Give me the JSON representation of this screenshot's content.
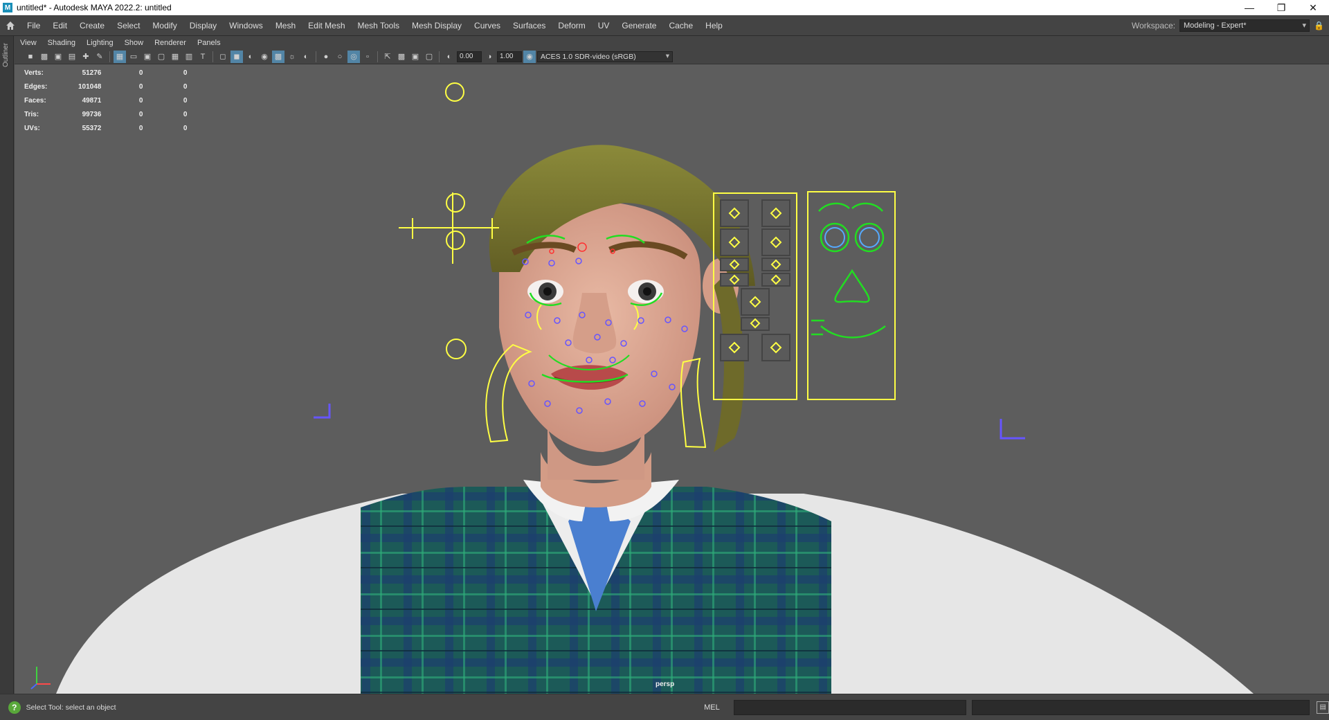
{
  "window": {
    "title": "untitled* - Autodesk MAYA 2022.2: untitled",
    "icon": "maya-icon",
    "controls": [
      "minimize-icon",
      "restore-icon",
      "close-icon"
    ]
  },
  "menubar": {
    "items": [
      "File",
      "Edit",
      "Create",
      "Select",
      "Modify",
      "Display",
      "Windows",
      "Mesh",
      "Edit Mesh",
      "Mesh Tools",
      "Mesh Display",
      "Curves",
      "Surfaces",
      "Deform",
      "UV",
      "Generate",
      "Cache",
      "Help"
    ],
    "workspace_label": "Workspace:",
    "workspace_value": "Modeling - Expert*"
  },
  "outliner": {
    "label": "Outliner"
  },
  "panel_menu": {
    "items": [
      "View",
      "Shading",
      "Lighting",
      "Show",
      "Renderer",
      "Panels"
    ]
  },
  "toolbar": {
    "exposure": "0.00",
    "gamma": "1.00",
    "color_space": "ACES 1.0 SDR-video (sRGB)"
  },
  "hud": {
    "rows": [
      {
        "label": "Verts:",
        "value": "51276",
        "a": "0",
        "b": "0"
      },
      {
        "label": "Edges:",
        "value": "101048",
        "a": "0",
        "b": "0"
      },
      {
        "label": "Faces:",
        "value": "49871",
        "a": "0",
        "b": "0"
      },
      {
        "label": "Tris:",
        "value": "99736",
        "a": "0",
        "b": "0"
      },
      {
        "label": "UVs:",
        "value": "55372",
        "a": "0",
        "b": "0"
      }
    ]
  },
  "viewport": {
    "camera": "persp",
    "background": "#5d5d5d",
    "control_color": "#ffff44",
    "face_ctrl_color": "#22dd22"
  },
  "status": {
    "help_text": "Select Tool: select an object",
    "cmd_type": "MEL"
  }
}
